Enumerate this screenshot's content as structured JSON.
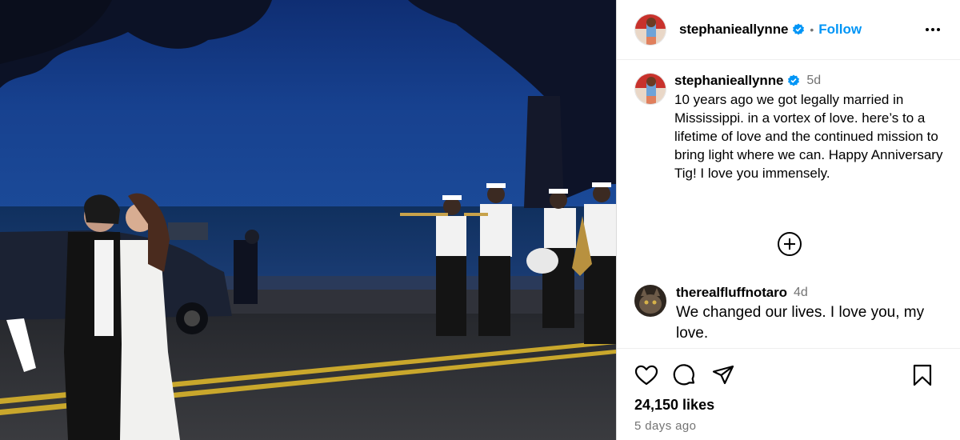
{
  "post": {
    "image": {
      "alt": ""
    },
    "header": {
      "username": "stephanieallynne",
      "separator": "•",
      "follow_label": "Follow",
      "more_icon": "more-horizontal-icon"
    },
    "caption": {
      "username": "stephanieallynne",
      "time": "5d",
      "text": "10 years ago we got legally married in Mississippi. in a vortex of love. here’s to a lifetime of love and the continued mission to bring light where we can. Happy Anniversary Tig! I love you immensely."
    },
    "load_more_icon": "plus-circle-icon",
    "comments": [
      {
        "username": "therealfluffnotaro",
        "time": "4d",
        "text": "We changed our lives. I love you, my love."
      }
    ],
    "actions": {
      "like_icon": "heart-icon",
      "comment_icon": "comment-icon",
      "share_icon": "send-icon",
      "save_icon": "bookmark-icon"
    },
    "likes": "24,150 likes",
    "posted": "5 days ago",
    "colors": {
      "accent": "#0095f6",
      "muted": "#737373",
      "verified": "#0095f6"
    }
  }
}
